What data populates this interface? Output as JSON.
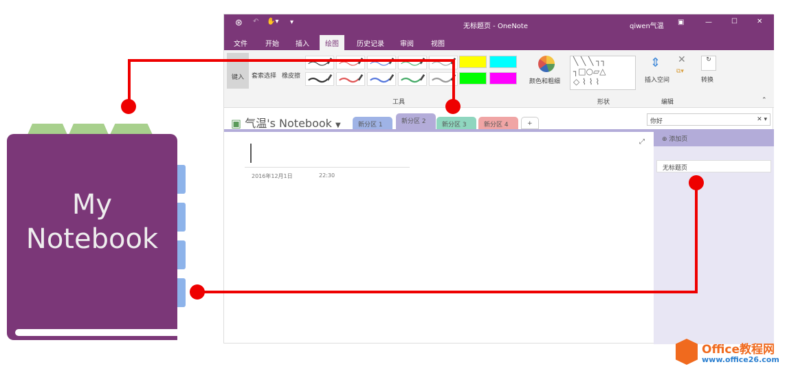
{
  "book": {
    "title_line1": "My",
    "title_line2": "Notebook"
  },
  "window": {
    "title": "无标题页 - OneNote",
    "user": "qiwen气温",
    "menu": [
      "文件",
      "开始",
      "插入",
      "绘图",
      "历史记录",
      "审阅",
      "视图"
    ],
    "active_menu": "绘图",
    "ribbon": {
      "type_label": "键入",
      "lasso_label": "套索选择",
      "eraser_label": "橡皮擦",
      "tools_group": "工具",
      "color_label": "颜色和粗细",
      "shapes_group": "形状",
      "insert_space_label": "插入空间",
      "edit_group": "编辑",
      "convert_label": "转换",
      "pen_colors": [
        "#333333",
        "#e05555",
        "#5577dd",
        "#44aa66",
        "#999999"
      ],
      "highlighter_colors": [
        "#ffff00",
        "#00ffff",
        "#00ff00",
        "#ff00ff"
      ]
    },
    "notebook_name": "气温's Notebook",
    "sections": [
      {
        "label": "新分区 1",
        "color": "#9fb3e6"
      },
      {
        "label": "新分区 2",
        "color": "#b3acd9"
      },
      {
        "label": "新分区 3",
        "color": "#8fd6bf"
      },
      {
        "label": "新分区 4",
        "color": "#f0a5a5"
      }
    ],
    "add_section": "+",
    "search_value": "你好",
    "page_date": "2016年12月1日",
    "page_time": "22:30",
    "add_page": "添加页",
    "pages": [
      "无标题页"
    ]
  },
  "watermark": {
    "brand": "Office教程网",
    "url": "www.office26.com"
  }
}
